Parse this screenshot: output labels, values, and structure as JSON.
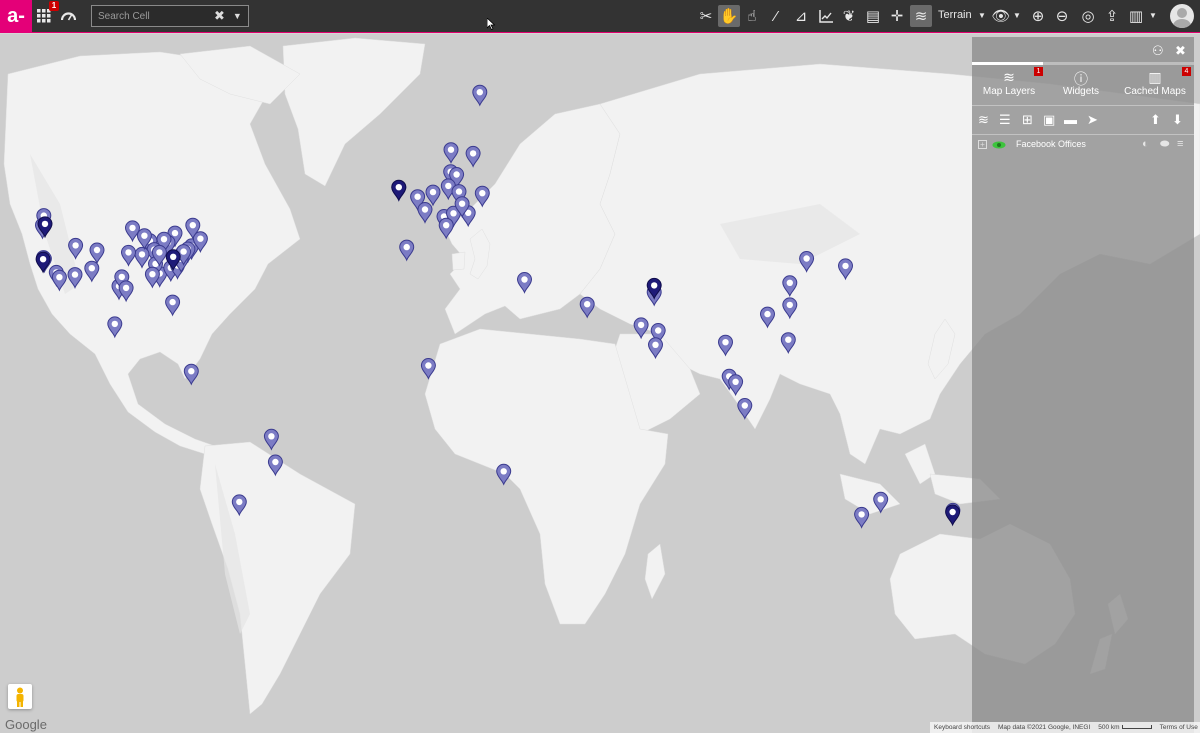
{
  "toolbar": {
    "logo_text": "a-",
    "apps_badge": "1",
    "search_placeholder": "Search Cell",
    "basemap_label": "Terrain",
    "icons": [
      "tools-icon",
      "hand-pan-icon",
      "pointer-hand-icon",
      "magic-wand-icon",
      "measure-icon",
      "chart-icon",
      "leaf-icon",
      "map-image-icon",
      "crosshair-icon",
      "layers-icon",
      "eye-icon",
      "zoom-in-icon",
      "zoom-out-icon",
      "globe-icon",
      "share-icon",
      "map-icon",
      "user-avatar-icon"
    ]
  },
  "panel": {
    "progress_percent": 32,
    "tabs": [
      {
        "label": "Map Layers",
        "badge": "1",
        "icon": "layers-icon"
      },
      {
        "label": "Widgets",
        "badge": "",
        "icon": "info-icon"
      },
      {
        "label": "Cached Maps",
        "badge": "4",
        "icon": "map-icon"
      }
    ],
    "layer": {
      "name": "Facebook Offices",
      "visible": true
    }
  },
  "map": {
    "google_label": "Google",
    "attribution": {
      "shortcuts": "Keyboard shortcuts",
      "data": "Map data ©2021 Google, INEGI",
      "scale": "500 km",
      "terms": "Terms of Use"
    },
    "pin_color": "#7c7cc4",
    "pin_dark_color": "#1e1a78",
    "pins": [
      {
        "lon": 20.2,
        "lat": 67.9
      },
      {
        "lon": 10.8,
        "lat": 59.9
      },
      {
        "lon": 18.0,
        "lat": 59.3
      },
      {
        "lon": -6.26,
        "lat": 53.3
      },
      {
        "lon": 10.7,
        "lat": 56.2
      },
      {
        "lon": 12.6,
        "lat": 55.7
      },
      {
        "lon": 9.9,
        "lat": 53.6
      },
      {
        "lon": 13.4,
        "lat": 52.5
      },
      {
        "lon": 4.9,
        "lat": 52.4
      },
      {
        "lon": -0.12,
        "lat": 51.5
      },
      {
        "lon": 2.3,
        "lat": 48.9
      },
      {
        "lon": 8.5,
        "lat": 47.4
      },
      {
        "lon": 11.6,
        "lat": 48.1
      },
      {
        "lon": 16.4,
        "lat": 48.2
      },
      {
        "lon": 21.0,
        "lat": 52.2
      },
      {
        "lon": 14.4,
        "lat": 50.1
      },
      {
        "lon": 9.2,
        "lat": 45.5
      },
      {
        "lon": -3.7,
        "lat": 40.4
      },
      {
        "lon": 34.8,
        "lat": 32.1
      },
      {
        "lon": 55.3,
        "lat": 25.2
      },
      {
        "lon": 77.2,
        "lat": 28.6
      },
      {
        "lon": 72.9,
        "lat": 19.1
      },
      {
        "lon": 78.5,
        "lat": 17.4
      },
      {
        "lon": 77.6,
        "lat": 13.0
      },
      {
        "lon": 3.4,
        "lat": 6.5
      },
      {
        "lon": 28.0,
        "lat": -26.2
      },
      {
        "lon": 100.5,
        "lat": 13.8
      },
      {
        "lon": 101.7,
        "lat": 3.1
      },
      {
        "lon": 103.8,
        "lat": 1.35
      },
      {
        "lon": 106.8,
        "lat": -6.2
      },
      {
        "lon": 121.0,
        "lat": 14.6
      },
      {
        "lon": 114.2,
        "lat": 22.3
      },
      {
        "lon": 121.5,
        "lat": 25.0
      },
      {
        "lon": 126.98,
        "lat": 37.57
      },
      {
        "lon": 121.5,
        "lat": 31.2
      },
      {
        "lon": 139.7,
        "lat": 35.7
      },
      {
        "lon": 151.2,
        "lat": -33.9
      },
      {
        "lon": 144.96,
        "lat": -37.8
      },
      {
        "lon": 174.8,
        "lat": -36.8
      },
      {
        "lon": -46.6,
        "lat": -23.5
      },
      {
        "lon": -47.9,
        "lat": -15.8
      },
      {
        "lon": -58.4,
        "lat": -34.6
      },
      {
        "lon": -74.1,
        "lat": 4.7
      },
      {
        "lon": -99.1,
        "lat": 19.4
      },
      {
        "lon": -122.3,
        "lat": 47.6
      },
      {
        "lon": -122.7,
        "lat": 45.5
      },
      {
        "lon": -122.4,
        "lat": 37.8
      },
      {
        "lon": -122.1,
        "lat": 37.5
      },
      {
        "lon": -118.2,
        "lat": 34.0
      },
      {
        "lon": -117.2,
        "lat": 32.7
      },
      {
        "lon": -111.9,
        "lat": 40.8
      },
      {
        "lon": -104.9,
        "lat": 39.7
      },
      {
        "lon": -112.1,
        "lat": 33.4
      },
      {
        "lon": -97.7,
        "lat": 30.3
      },
      {
        "lon": -96.8,
        "lat": 32.8
      },
      {
        "lon": -95.4,
        "lat": 29.8
      },
      {
        "lon": -93.3,
        "lat": 44.9
      },
      {
        "lon": -87.6,
        "lat": 41.9
      },
      {
        "lon": -84.4,
        "lat": 33.7
      },
      {
        "lon": -80.2,
        "lat": 25.8
      },
      {
        "lon": -77.0,
        "lat": 38.9
      },
      {
        "lon": -74.0,
        "lat": 40.7
      },
      {
        "lon": -71.1,
        "lat": 42.4
      },
      {
        "lon": -79.4,
        "lat": 43.7
      },
      {
        "lon": -75.2,
        "lat": 39.95
      },
      {
        "lon": -81.7,
        "lat": 41.5
      },
      {
        "lon": -83.0,
        "lat": 42.3
      },
      {
        "lon": -86.2,
        "lat": 39.8
      },
      {
        "lon": -90.2,
        "lat": 38.6
      },
      {
        "lon": -85.8,
        "lat": 36.2
      },
      {
        "lon": -80.8,
        "lat": 35.2
      },
      {
        "lon": -78.6,
        "lat": 35.8
      },
      {
        "lon": -77.4,
        "lat": 37.5
      },
      {
        "lon": -86.8,
        "lat": 33.5
      },
      {
        "lon": -94.6,
        "lat": 39.1
      },
      {
        "lon": -84.5,
        "lat": 39.1
      },
      {
        "lon": -89.4,
        "lat": 43.1
      },
      {
        "lon": -73.6,
        "lat": 45.5
      },
      {
        "lon": -76.6,
        "lat": 39.3
      },
      {
        "lon": -106.6,
        "lat": 35.1
      }
    ],
    "dark_pins": [
      {
        "lon": -6.26,
        "lat": 53.35
      },
      {
        "lon": -122.5,
        "lat": 37.4
      },
      {
        "lon": -121.9,
        "lat": 45.8
      },
      {
        "lon": 77.2,
        "lat": 30.5
      },
      {
        "lon": 174.7,
        "lat": -37.2
      },
      {
        "lon": -80.0,
        "lat": 38.0
      }
    ]
  }
}
